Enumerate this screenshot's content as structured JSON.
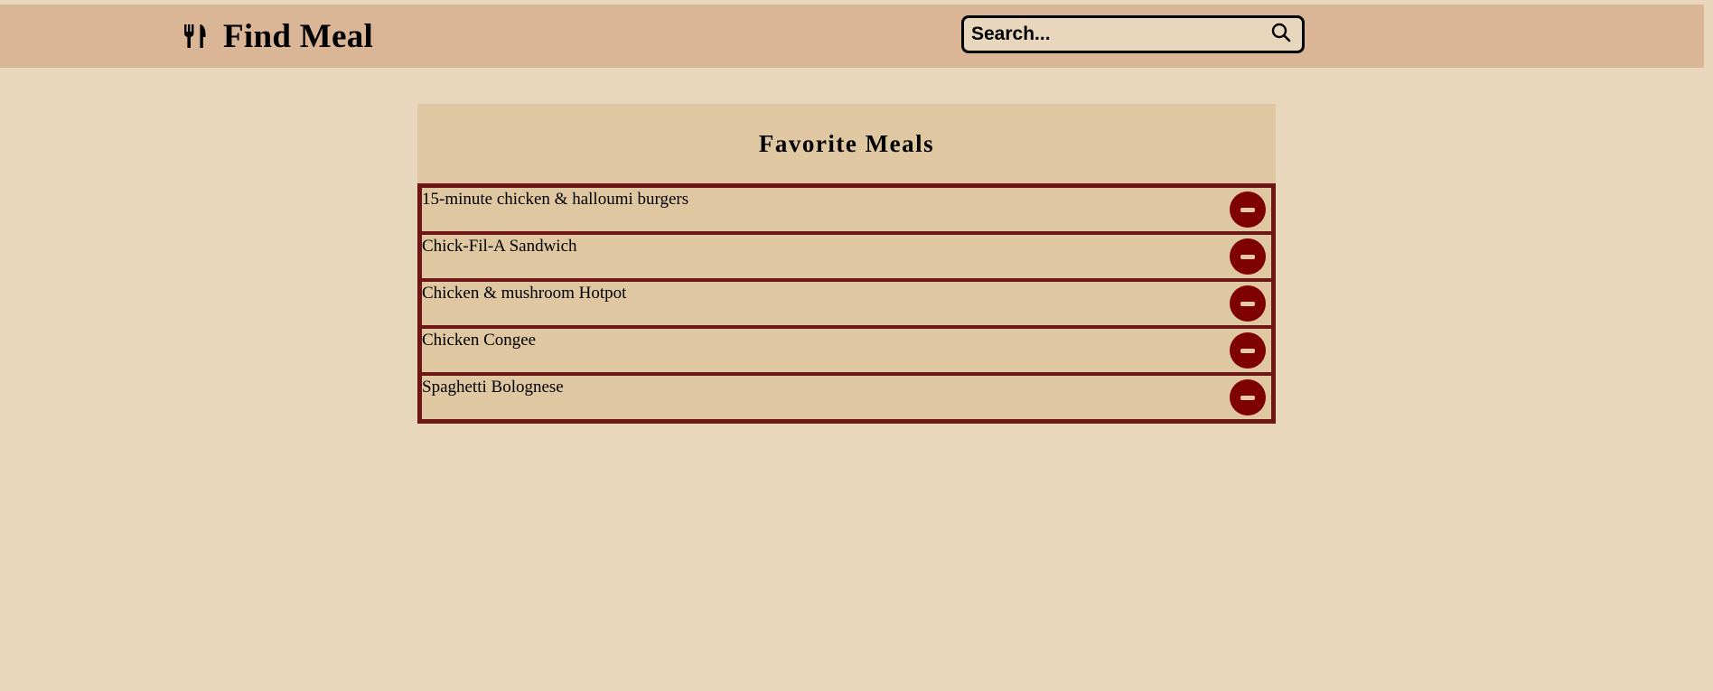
{
  "header": {
    "app_title": "Find Meal",
    "logo_icon": "utensils-icon"
  },
  "search": {
    "placeholder": "Search...",
    "icon": "search-icon"
  },
  "favorites": {
    "title": "Favorite Meals",
    "remove_icon": "minus-circle-icon",
    "items": [
      {
        "name": "15-minute chicken & halloumi burgers"
      },
      {
        "name": "Chick-Fil-A Sandwich"
      },
      {
        "name": "Chicken & mushroom Hotpot"
      },
      {
        "name": "Chicken Congee"
      },
      {
        "name": "Spaghetti Bolognese"
      }
    ]
  },
  "colors": {
    "page_background": "#e8d7bc",
    "header_background": "#dab596",
    "panel_background": "#dfc7a2",
    "list_border": "#6e1616",
    "remove_button": "#7f0000"
  }
}
